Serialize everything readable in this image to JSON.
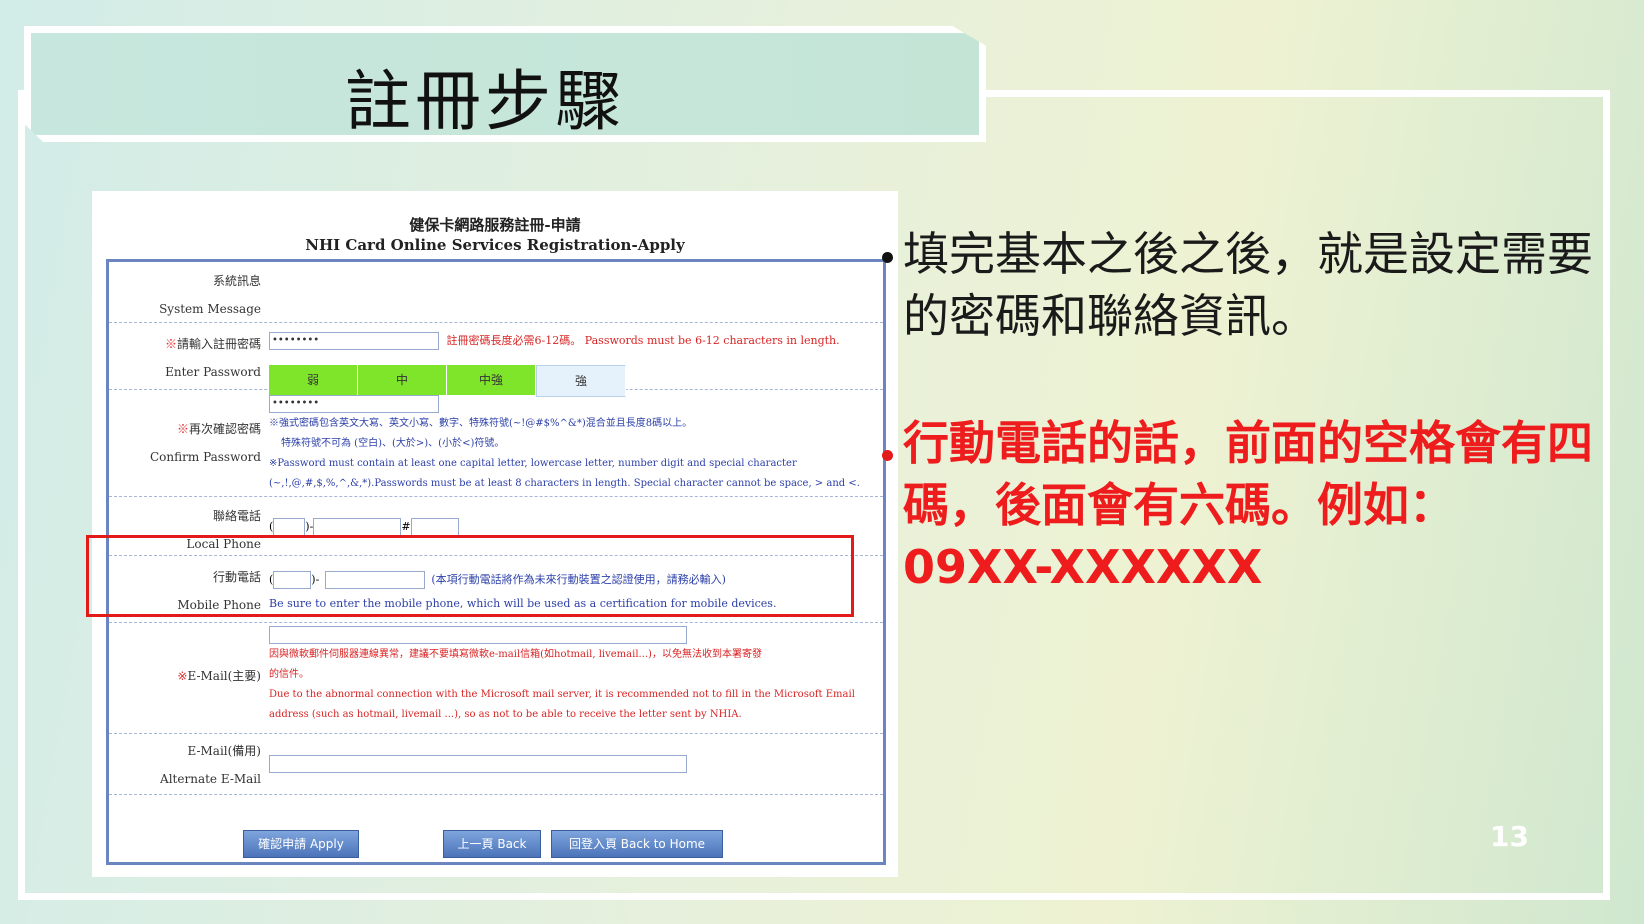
{
  "slide": {
    "title": "註冊步驟",
    "page_number": "13",
    "paragraph_black": "填完基本之後之後，就是設定需要的密碼和聯絡資訊。",
    "paragraph_red": "行動電話的話，前面的空格會有四碼，後面會有六碼。例如：09XX-XXXXXX",
    "colors": {
      "bullet_black": "#111111",
      "bullet_red": "#e21a1a",
      "highlight_text": "#ee1c1c",
      "highlight_box": "#e21a1a"
    }
  },
  "form": {
    "title_zh": "健保卡網路服務註冊-申請",
    "title_en": "NHI Card Online Services Registration-Apply",
    "system_message": {
      "zh": "系統訊息",
      "en": "System Message"
    },
    "enter_password": {
      "star": "※",
      "zh": "請輸入註冊密碼",
      "en": "Enter Password",
      "value": "••••••••",
      "hint": "註冊密碼長度必需6-12碼。 Passwords must be 6-12 characters in length.",
      "strength": [
        "弱",
        "中",
        "中強",
        "強"
      ]
    },
    "confirm_password": {
      "star": "※",
      "zh": "再次確認密碼",
      "en": "Confirm Password",
      "value": "••••••••",
      "note1": "※強式密碼包含英文大寫、英文小寫、數字、特殊符號(~!@#$%^&*)混合並且長度8碼以上。",
      "note2": "特殊符號不可為 (空白)、(大於>)、(小於<)符號。",
      "note3": "※Password must contain at least one capital letter, lowercase letter, number digit and special character",
      "note4": "(~,!,@,#,$,%,^,&,*).Passwords must be at least 8 characters in length. Special character cannot be space, > and <."
    },
    "local_phone": {
      "zh": "聯絡電話",
      "en": "Local Phone"
    },
    "mobile_phone": {
      "zh": "行動電話",
      "en": "Mobile Phone",
      "note_zh": "(本項行動電話將作為未來行動裝置之認證使用，請務必輸入)",
      "note_en": "Be sure to enter the mobile phone, which will be used as a certification for mobile devices."
    },
    "email_primary": {
      "star": "※",
      "zh": "E-Mail(主要)",
      "note_zh1": "因與微軟郵件伺服器連線異常，建議不要填寫微軟e-mail信箱(如hotmail, livemail...)，以免無法收到本署寄發",
      "note_zh2": "的信件。",
      "note_en1": "Due to the abnormal connection with the Microsoft mail server, it is recommended not to fill in the Microsoft Email",
      "note_en2": "address (such as hotmail, livemail ...), so as not to be able to receive the letter sent by NHIA."
    },
    "email_alt": {
      "zh": "E-Mail(備用)",
      "en": "Alternate E-Mail"
    },
    "buttons": {
      "apply": "確認申請 Apply",
      "back": "上一頁 Back",
      "home": "回登入頁 Back to Home"
    }
  }
}
